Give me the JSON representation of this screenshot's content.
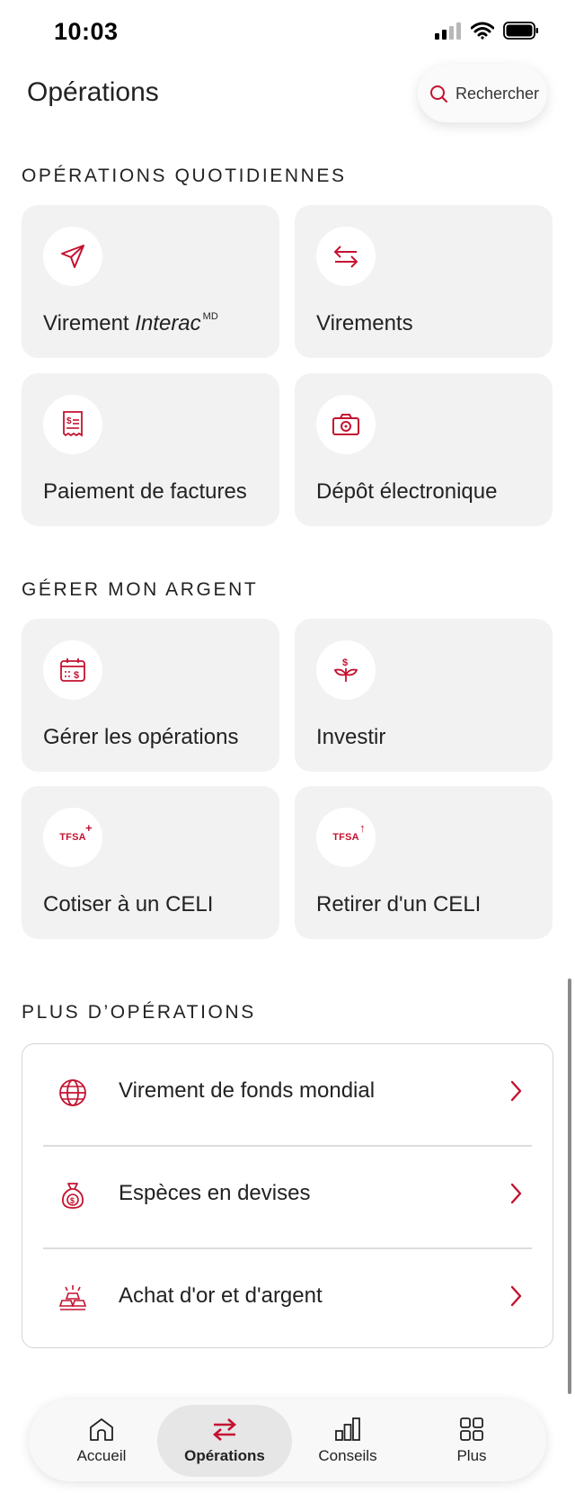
{
  "status_bar": {
    "time": "10:03"
  },
  "header": {
    "title": "Opérations",
    "search_label": "Rechercher"
  },
  "sections": {
    "daily": "OPÉRATIONS QUOTIDIENNES",
    "manage": "GÉRER MON ARGENT",
    "more": "PLUS D’OPÉRATIONS"
  },
  "daily_tiles": [
    {
      "label_main": "Virement ",
      "label_italic": "Interac",
      "label_sup": "MD",
      "icon": "send-icon"
    },
    {
      "label": "Virements",
      "icon": "transfer-arrows-icon"
    },
    {
      "label": "Paiement de factures",
      "icon": "bill-receipt-icon"
    },
    {
      "label": "Dépôt électronique",
      "icon": "camera-icon"
    }
  ],
  "manage_tiles": [
    {
      "label": "Gérer les opérations",
      "icon": "calendar-dollar-icon"
    },
    {
      "label": "Investir",
      "icon": "plant-dollar-icon"
    },
    {
      "label": "Cotiser à un CELI",
      "badge": "TFSA",
      "icon": "tfsa-plus-icon"
    },
    {
      "label": "Retirer d'un CELI",
      "badge": "TFSA",
      "icon": "tfsa-withdraw-icon"
    }
  ],
  "more_list": [
    {
      "label": "Virement de fonds mondial",
      "icon": "globe-icon"
    },
    {
      "label": "Espèces en devises",
      "icon": "money-bag-icon"
    },
    {
      "label": "Achat d'or et d'argent",
      "icon": "gold-bars-icon"
    }
  ],
  "bottom_nav": [
    {
      "label": "Accueil",
      "icon": "home-icon",
      "active": false
    },
    {
      "label": "Opérations",
      "icon": "swap-icon",
      "active": true
    },
    {
      "label": "Conseils",
      "icon": "bar-chart-icon",
      "active": false
    },
    {
      "label": "Plus",
      "icon": "grid-icon",
      "active": false
    }
  ],
  "colors": {
    "accent": "#c41230",
    "tile_bg": "#f2f2f2"
  }
}
